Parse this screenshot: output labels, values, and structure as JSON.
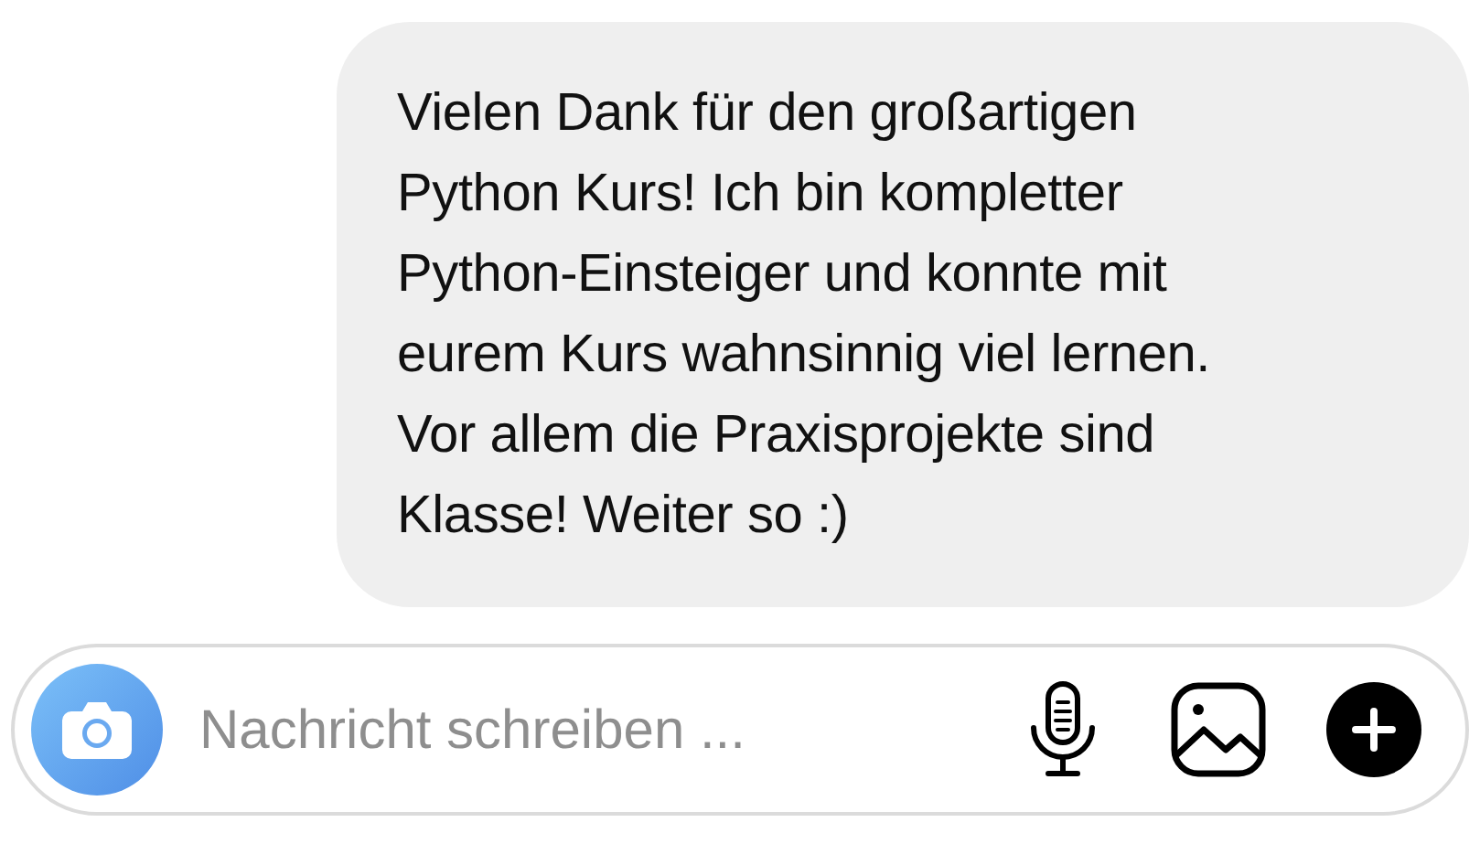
{
  "message": {
    "lines": [
      "Vielen Dank für den großartigen",
      "Python Kurs! Ich bin kompletter",
      "Python-Einsteiger und konnte mit",
      "eurem Kurs wahnsinnig viel lernen.",
      "Vor allem die Praxisprojekte sind",
      "Klasse! Weiter so :)"
    ]
  },
  "composer": {
    "placeholder": "Nachricht schreiben ..."
  }
}
